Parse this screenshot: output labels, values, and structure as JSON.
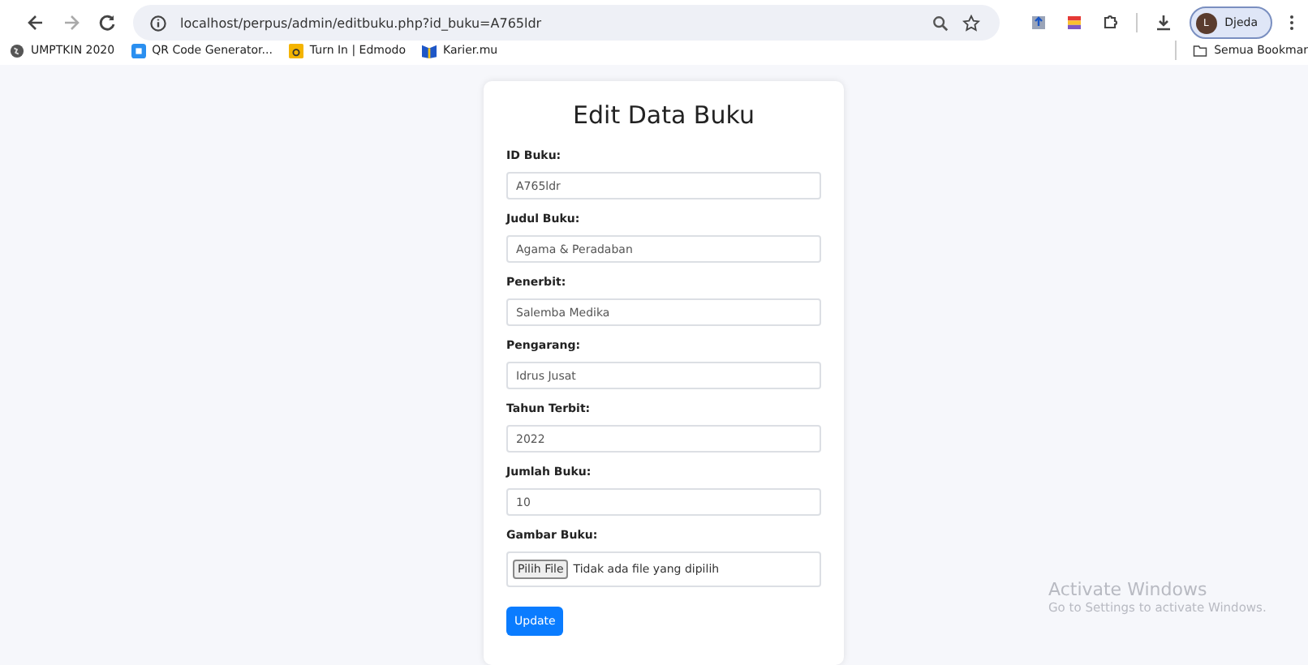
{
  "browser": {
    "url": "localhost/perpus/admin/editbuku.php?id_buku=A765ldr",
    "profile": {
      "initial": "L",
      "name": "Djeda"
    }
  },
  "bookmarks": [
    "UMPTKIN 2020",
    "QR Code Generator...",
    "Turn In | Edmodo",
    "Karier.mu"
  ],
  "all_bookmarks": "Semua Bookmar",
  "form": {
    "title": "Edit Data Buku",
    "fields": [
      {
        "kind": "text",
        "label": "ID Buku:",
        "value": "A765ldr"
      },
      {
        "kind": "text",
        "label": "Judul Buku:",
        "value": "Agama & Peradaban"
      },
      {
        "kind": "text",
        "label": "Penerbit:",
        "value": "Salemba Medika"
      },
      {
        "kind": "text",
        "label": "Pengarang:",
        "value": "Idrus Jusat"
      },
      {
        "kind": "text",
        "label": "Tahun Terbit:",
        "value": "2022"
      },
      {
        "kind": "text",
        "label": "Jumlah Buku:",
        "value": "10"
      },
      {
        "kind": "file",
        "label": "Gambar Buku:",
        "button": "Pilih File",
        "status": "Tidak ada file yang dipilih"
      }
    ],
    "submit": "Update"
  },
  "activation": {
    "title": "Activate Windows",
    "subtitle": "Go to Settings to activate Windows."
  }
}
